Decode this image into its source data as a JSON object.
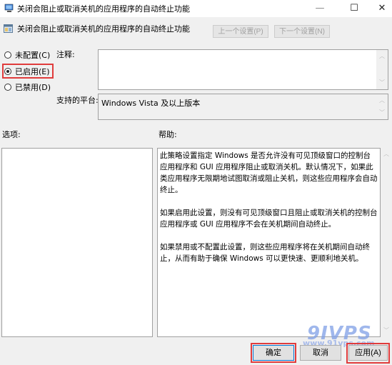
{
  "window": {
    "title": "关闭会阻止或取消关机的应用程序的自动终止功能",
    "controls": {
      "minimize": "—",
      "maximize": "☐",
      "close": "✕"
    }
  },
  "header": {
    "setting_title": "关闭会阻止或取消关机的应用程序的自动终止功能",
    "prev_button": "上一个设置(P)",
    "next_button": "下一个设置(N)"
  },
  "state": {
    "options": [
      {
        "label": "未配置(C)",
        "checked": false
      },
      {
        "label": "已启用(E)",
        "checked": true,
        "highlighted": true
      },
      {
        "label": "已禁用(D)",
        "checked": false
      }
    ]
  },
  "comment": {
    "label": "注释:",
    "value": ""
  },
  "platform": {
    "label": "支持的平台:",
    "value": "Windows Vista 及以上版本"
  },
  "options_section": {
    "label": "选项:"
  },
  "help_section": {
    "label": "帮助:",
    "paragraphs": [
      "此策略设置指定 Windows 是否允许没有可见顶级窗口的控制台应用程序和 GUI 应用程序阻止或取消关机。默认情况下，如果此类应用程序无限期地试图取消或阻止关机，则这些应用程序会自动终止。",
      "如果启用此设置，则没有可见顶级窗口且阻止或取消关机的控制台应用程序或 GUI 应用程序不会在关机期间自动终止。",
      "如果禁用或不配置此设置，则这些应用程序将在关机期间自动终止，从而有助于确保 Windows 可以更快速、更顺利地关机。"
    ]
  },
  "footer": {
    "ok": "确定",
    "cancel": "取消",
    "apply": "应用(A)"
  },
  "watermark": {
    "logo": "9IVPS",
    "url": "www.91vps.com"
  },
  "colors": {
    "highlight": "#e03c3c",
    "focus": "#0078d7",
    "background": "#f0f0f0"
  }
}
